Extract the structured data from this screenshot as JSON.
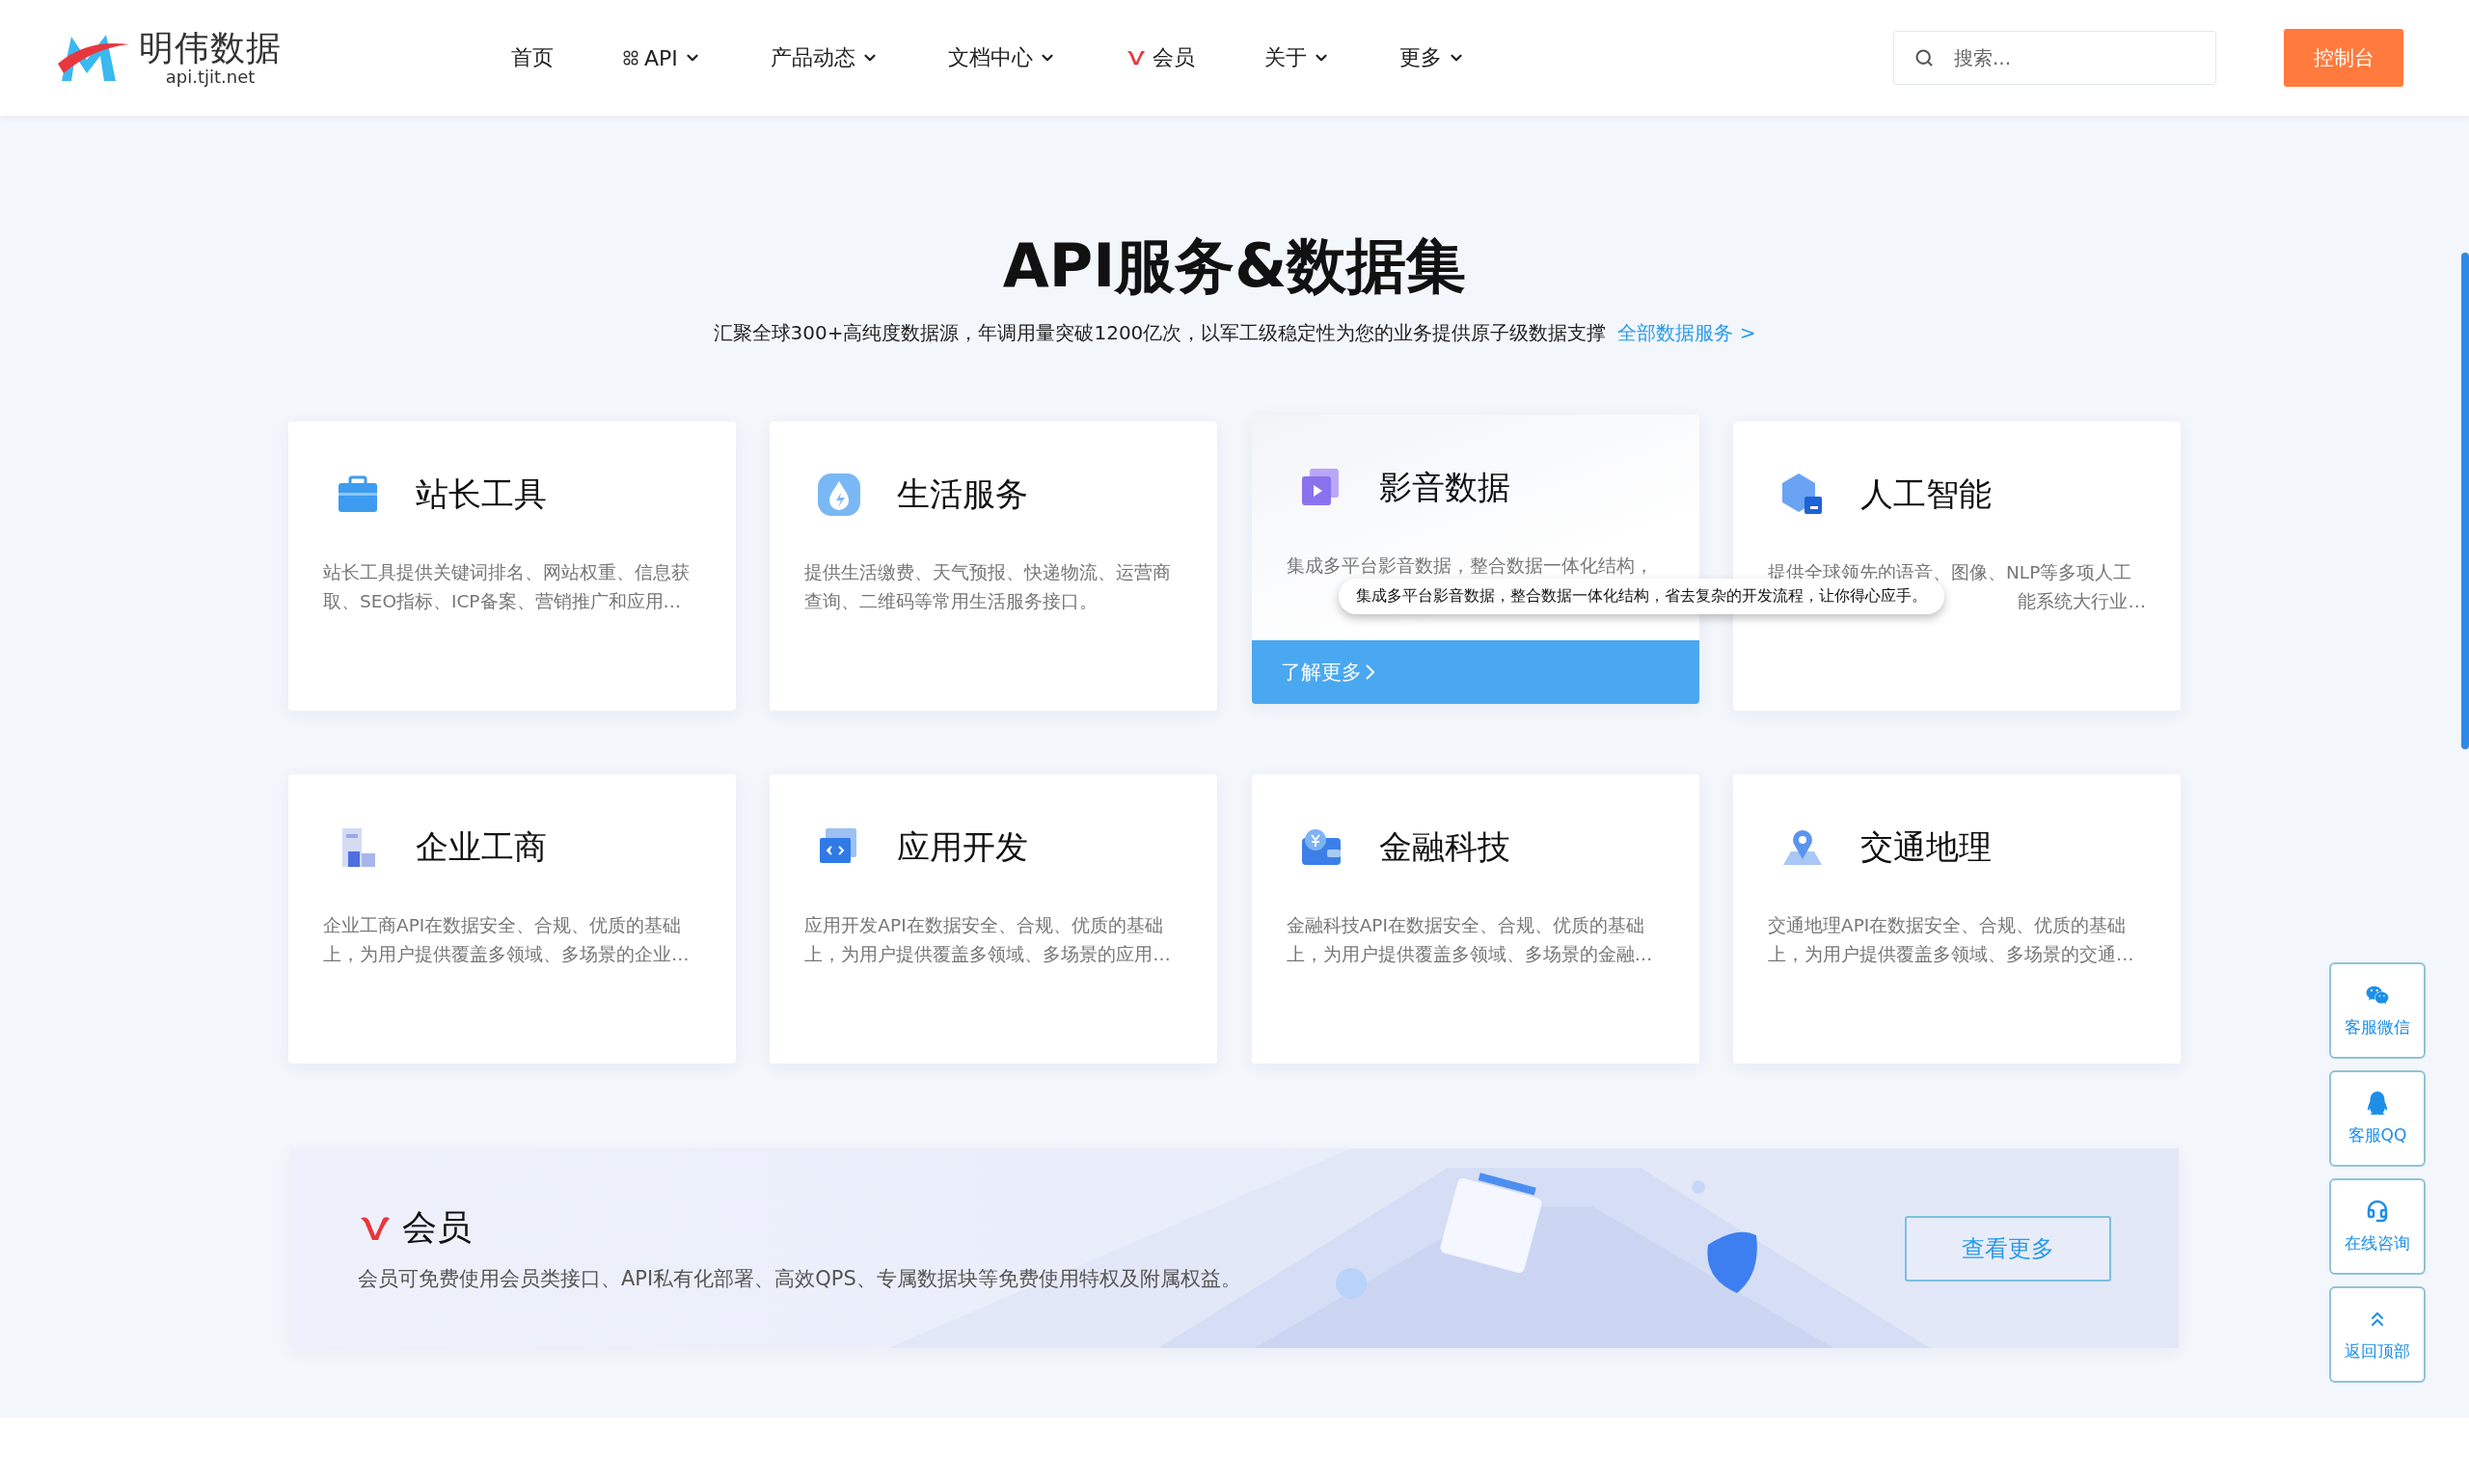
{
  "header": {
    "logo": {
      "name": "明伟数据",
      "domain": "api.tjit.net"
    },
    "nav": [
      {
        "label": "首页",
        "dropdown": false
      },
      {
        "label": "API",
        "dropdown": true
      },
      {
        "label": "产品动态",
        "dropdown": true
      },
      {
        "label": "文档中心",
        "dropdown": true
      },
      {
        "label": "会员",
        "dropdown": false
      },
      {
        "label": "关于",
        "dropdown": true
      },
      {
        "label": "更多",
        "dropdown": true
      }
    ],
    "search": {
      "placeholder": "搜索..."
    },
    "console_button": "控制台"
  },
  "hero": {
    "title": "API服务&数据集",
    "subtitle": "汇聚全球300+高纯度数据源，年调用量突破1200亿次，以军工级稳定性为您的业务提供原子级数据支撑",
    "link": "全部数据服务 >"
  },
  "cards": [
    {
      "title": "站长工具",
      "description": "站长工具提供关键词排名、网站权重、信息获取、SEO指标、ICP备案、营销推广和应用…",
      "hovered": false
    },
    {
      "title": "生活服务",
      "description": "提供生活缴费、天气预报、快递物流、运营商查询、二维码等常用生活服务接口。",
      "hovered": false
    },
    {
      "title": "影音数据",
      "description": "集成多平台影音数据，整合数据一体化结构，",
      "hovered": true,
      "more_link": "了解更多",
      "tooltip": "集成多平台影音数据，整合数据一体化结构，省去复杂的开发流程，让你得心应手。"
    },
    {
      "title": "人工智能",
      "description": "提供全球领先的语音、图像、NLP等多项人工",
      "description_end": "能系统大行业…",
      "hovered": false
    },
    {
      "title": "企业工商",
      "description": "企业工商API在数据安全、合规、优质的基础上，为用户提供覆盖多领域、多场景的企业…",
      "hovered": false
    },
    {
      "title": "应用开发",
      "description": "应用开发API在数据安全、合规、优质的基础上，为用户提供覆盖多领域、多场景的应用…",
      "hovered": false
    },
    {
      "title": "金融科技",
      "description": "金融科技API在数据安全、合规、优质的基础上，为用户提供覆盖多领域、多场景的金融…",
      "hovered": false
    },
    {
      "title": "交通地理",
      "description": "交通地理API在数据安全、合规、优质的基础上，为用户提供覆盖多领域、多场景的交通…",
      "hovered": false
    }
  ],
  "member": {
    "title": "会员",
    "description": "会员可免费使用会员类接口、API私有化部署、高效QPS、专属数据块等免费使用特权及附属权益。",
    "button": "查看更多"
  },
  "float_buttons": [
    {
      "label": "客服微信"
    },
    {
      "label": "客服QQ"
    },
    {
      "label": "在线咨询"
    },
    {
      "label": "返回顶部"
    }
  ]
}
